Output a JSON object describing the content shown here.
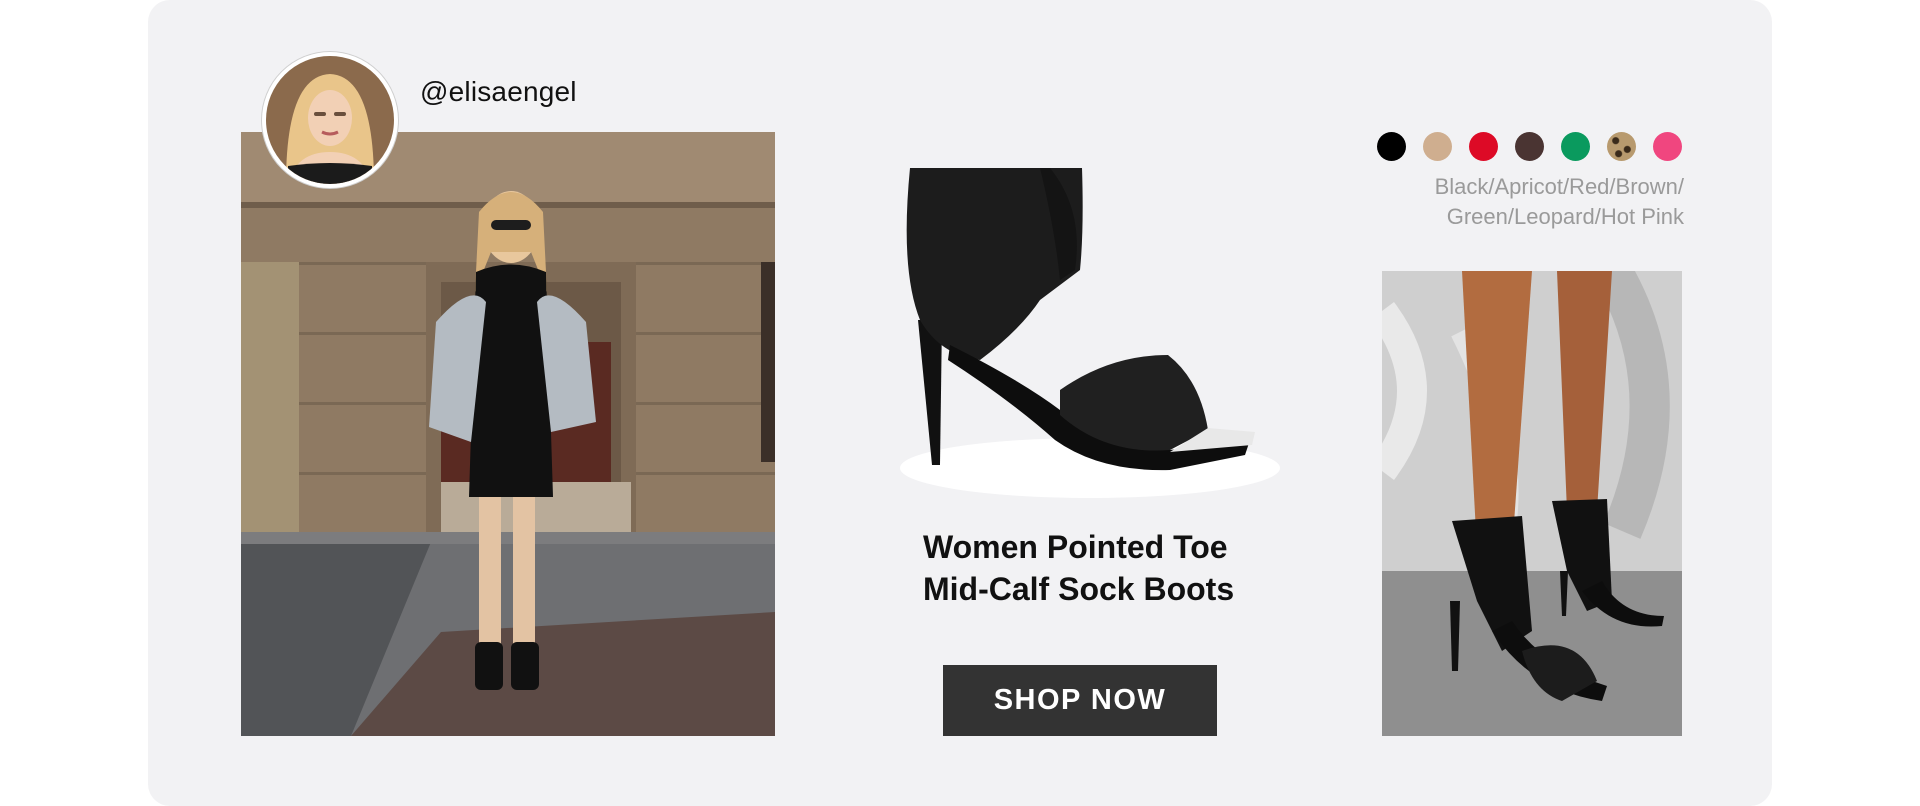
{
  "creator": {
    "handle": "@elisaengel",
    "avatar_icon": "creator-avatar"
  },
  "product": {
    "title_line1": "Women Pointed Toe",
    "title_line2": "Mid-Calf Sock Boots",
    "cta_label": "SHOP NOW"
  },
  "colors": {
    "swatches": [
      {
        "name": "Black",
        "hex": "#000000"
      },
      {
        "name": "Apricot",
        "hex": "#cfae8f"
      },
      {
        "name": "Red",
        "hex": "#dd0a26"
      },
      {
        "name": "Brown",
        "hex": "#4a3432"
      },
      {
        "name": "Green",
        "hex": "#0a9a5e"
      },
      {
        "name": "Leopard",
        "hex": "#8c7553"
      },
      {
        "name": "Hot Pink",
        "hex": "#f0467f"
      }
    ],
    "label_line1": "Black/Apricot/Red/Brown/",
    "label_line2": "Green/Leopard/Hot Pink"
  },
  "theme": {
    "card_bg": "#f2f2f4",
    "button_bg": "#333333",
    "label_color": "#9a9a9a"
  }
}
